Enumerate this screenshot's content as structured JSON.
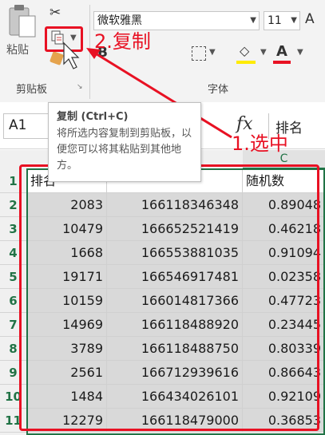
{
  "ribbon": {
    "paste_label": "粘贴",
    "clipboard_group": "剪贴板",
    "font_group": "字体",
    "font_name": "微软雅黑",
    "font_size": "11",
    "grow_font": "A",
    "bold": "B",
    "font_color_glyph": "A",
    "fill_color": "#ffeb00",
    "font_color": "#e81123"
  },
  "formula_bar": {
    "name_box": "A1",
    "fx": "fx",
    "content": "排名"
  },
  "tooltip": {
    "title": "复制 (Ctrl+C)",
    "body": "将所选内容复制到剪贴板，以便您可以将其粘贴到其他地方。"
  },
  "grid": {
    "column_c": "C",
    "row_numbers": [
      "1",
      "2",
      "3",
      "4",
      "5",
      "6",
      "7",
      "8",
      "9",
      "10",
      "11"
    ],
    "header": [
      "排名",
      "",
      "随机数"
    ],
    "rows": [
      [
        "2083",
        "166118346348",
        "0.89048"
      ],
      [
        "10479",
        "166652521419",
        "0.46218"
      ],
      [
        "1668",
        "166553881035",
        "0.91094"
      ],
      [
        "19171",
        "166546917481",
        "0.02358"
      ],
      [
        "10159",
        "166014817366",
        "0.47723"
      ],
      [
        "14969",
        "166118488920",
        "0.23445"
      ],
      [
        "3789",
        "166118488750",
        "0.80339"
      ],
      [
        "2561",
        "166712939616",
        "0.86643"
      ],
      [
        "1484",
        "166434026101",
        "0.92109"
      ],
      [
        "12279",
        "166118479000",
        "0.36853"
      ]
    ]
  },
  "annotations": {
    "step1": "1.选中",
    "step2": "2.复制",
    "color": "#e81123"
  }
}
